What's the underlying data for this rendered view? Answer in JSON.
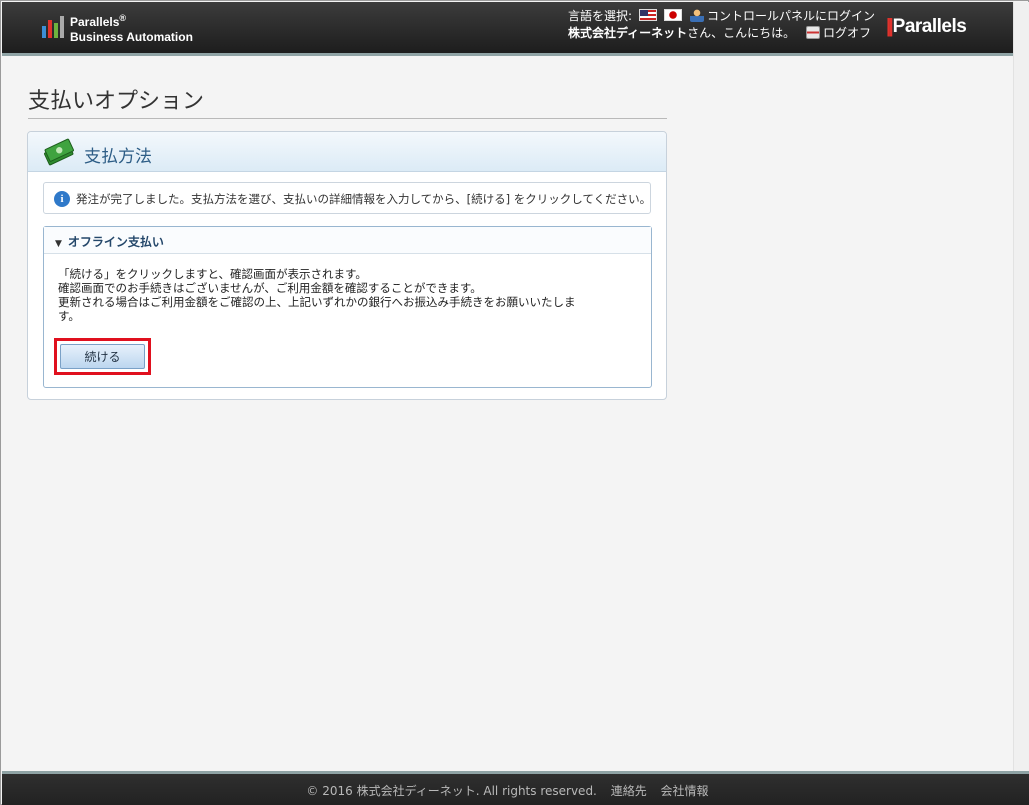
{
  "header": {
    "brand_line1": "Parallels",
    "brand_reg": "®",
    "brand_line2": "Business Automation",
    "language_label": "言語を選択:",
    "control_panel_login": "コントロールパネルにログイン",
    "company_name": "株式会社ディーネット",
    "greeting": "さん、こんにちは。",
    "logout": "ログオフ",
    "parallels_logo": "Parallels"
  },
  "page": {
    "title": "支払いオプション"
  },
  "panel": {
    "title": "支払方法",
    "info_message": "発注が完了しました。支払方法を選び、支払いの詳細情報を入力してから、[続ける] をクリックしてください。",
    "offline": {
      "title": "オフライン支払い",
      "desc_line1": "「続ける」をクリックしますと、確認画面が表示されます。",
      "desc_line2": "確認画面でのお手続きはございませんが、ご利用金額を確認することができます。",
      "desc_line3": "更新される場合はご利用金額をご確認の上、上記いずれかの銀行へお振込み手続きをお願いいたしま",
      "desc_line4": "す。",
      "continue_button": "続ける"
    }
  },
  "footer": {
    "copyright": "© 2016 株式会社ディーネット. All rights reserved.",
    "contact": "連絡先",
    "company_info": "会社情報"
  },
  "colors": {
    "header_bg": "#2a2a2a",
    "accent_blue": "#2d5d86",
    "highlight_red": "#e0101e"
  }
}
